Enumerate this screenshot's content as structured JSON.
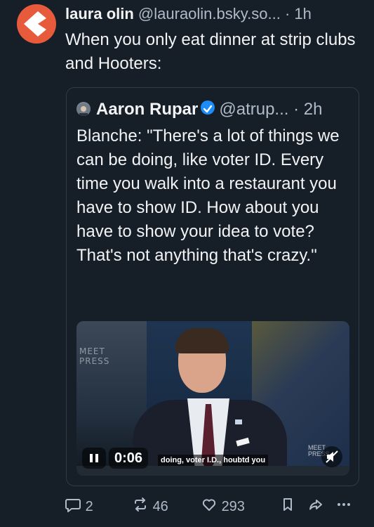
{
  "post": {
    "author_name": "laura olin",
    "handle": "@lauraolin.bsky.so...",
    "separator": "·",
    "time": "1h",
    "text": "When you only eat dinner at strip clubs and Hooters:"
  },
  "quote": {
    "author_name": "Aaron Rupar",
    "handle": "@atrup...",
    "separator": "·",
    "time": "2h",
    "text": "Blanche: \"There's a lot of things we can be doing, like voter ID. Every time you walk into a restaurant you have to show ID. How about you have to show your idea to vote? That's not anything that's crazy.\"",
    "video": {
      "watermark_line1": "MEET",
      "watermark_line2": "PRESS",
      "timestamp": "0:06",
      "caption": "doing, voter I.D., houbtd you",
      "logo_line1": "MEET",
      "logo_line2": "PRESS"
    }
  },
  "actions": {
    "reply_count": "2",
    "repost_count": "46",
    "like_count": "293"
  },
  "colors": {
    "background": "#161e27",
    "text": "#f1f3f5",
    "muted": "#aebbc9",
    "border": "#2e3b4a",
    "verified": "#1d8cf8",
    "avatar_accent": "#e85a3c"
  },
  "icons": {
    "reply": "speech-bubble-icon",
    "repost": "repost-arrows-icon",
    "like": "heart-icon",
    "bookmark": "bookmark-icon",
    "share": "share-arrow-icon",
    "more": "ellipsis-icon",
    "verified": "verified-check-icon",
    "pause": "pause-icon",
    "mute": "mute-icon"
  }
}
